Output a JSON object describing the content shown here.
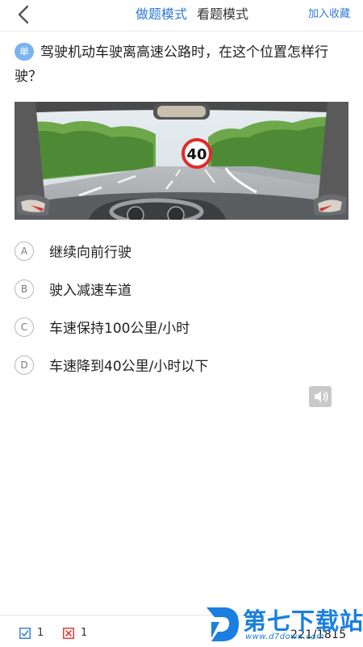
{
  "header": {
    "back_icon": "chevron-left-icon",
    "tabs": [
      {
        "label": "做题模式",
        "active": true
      },
      {
        "label": "看题模式",
        "active": false
      }
    ],
    "favorite_label": "加入收藏"
  },
  "question": {
    "type_badge": "单",
    "text": "驾驶机动车驶离高速公路时，在这个位置怎样行驶？",
    "image": {
      "sign_value": "40",
      "icon": "dashboard-road-scene-illustration"
    }
  },
  "options": [
    {
      "letter": "A",
      "text": "继续向前行驶"
    },
    {
      "letter": "B",
      "text": "驶入减速车道"
    },
    {
      "letter": "C",
      "text": "车速保持100公里/小时"
    },
    {
      "letter": "D",
      "text": "车速降到40公里/小时以下"
    }
  ],
  "speaker_icon": "speaker-icon",
  "footer": {
    "correct_count": "1",
    "wrong_count": "1",
    "progress": "221/1815"
  },
  "watermark": {
    "title": "第七下载站",
    "url": "www.d7down.com"
  },
  "colors": {
    "accent": "#2f79d6",
    "badge": "#7ab4ee",
    "correct": "#3a86d8",
    "wrong": "#e2423d"
  }
}
